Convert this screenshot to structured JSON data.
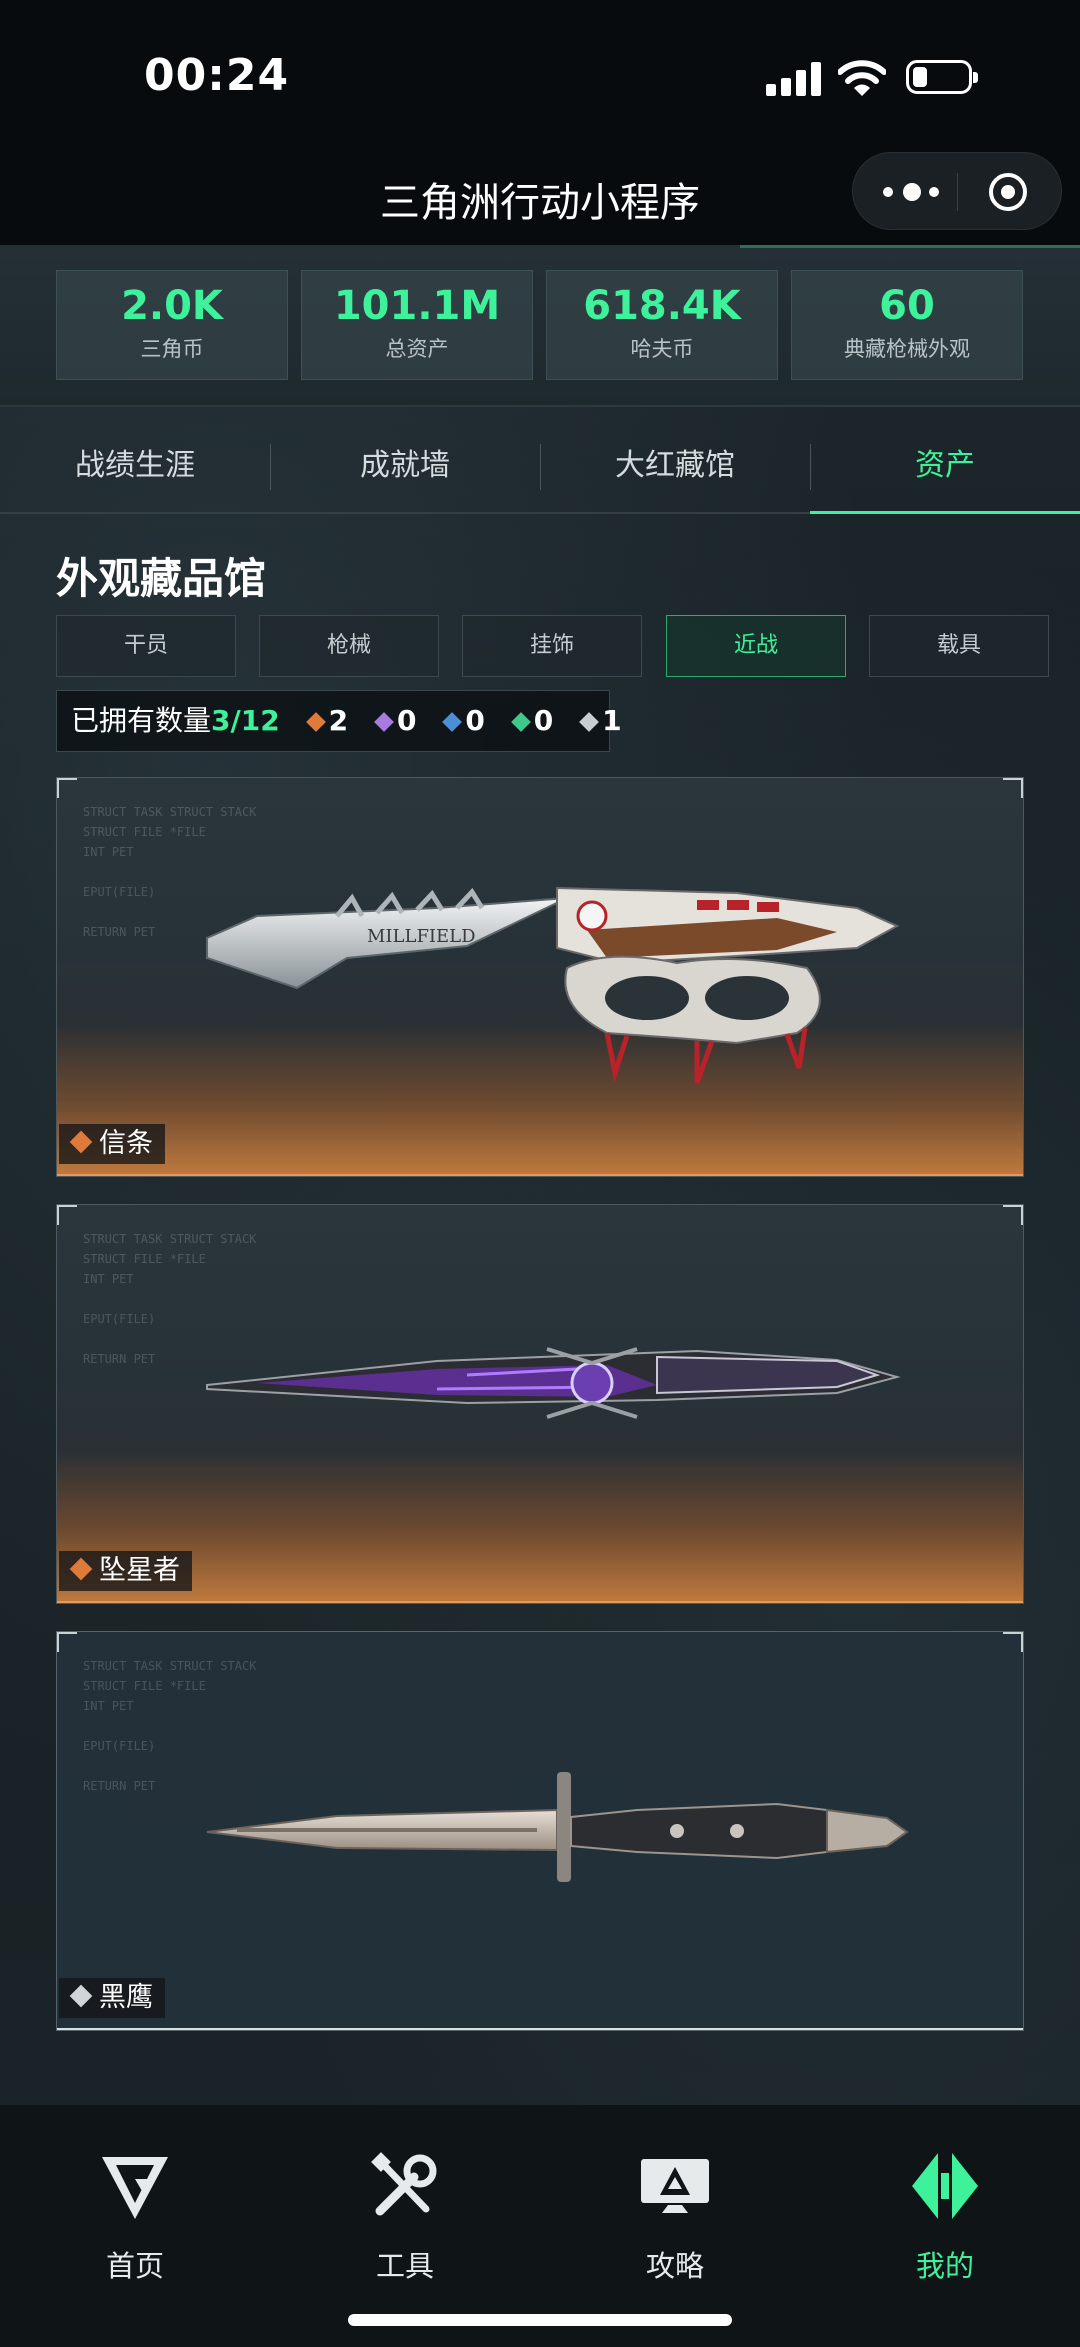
{
  "status_bar": {
    "time": "00:24"
  },
  "title_bar": {
    "title": "三角洲行动小程序"
  },
  "stats": [
    {
      "value": "2.0K",
      "label": "三角币"
    },
    {
      "value": "101.1M",
      "label": "总资产"
    },
    {
      "value": "618.4K",
      "label": "哈夫币"
    },
    {
      "value": "60",
      "label": "典藏枪械外观"
    }
  ],
  "tabs": [
    "战绩生涯",
    "成就墙",
    "大红藏馆",
    "资产"
  ],
  "active_tab": "资产",
  "section": {
    "title": "外观藏品馆",
    "categories": [
      "干员",
      "枪械",
      "挂饰",
      "近战",
      "载具"
    ],
    "active_category": "近战",
    "owned": {
      "label": "已拥有数量",
      "count": "3/12",
      "rarity_counts": [
        {
          "color": "#e07a3a",
          "count": "2"
        },
        {
          "color": "#a77be0",
          "count": "0"
        },
        {
          "color": "#4c8fd6",
          "count": "0"
        },
        {
          "color": "#3ec88a",
          "count": "0"
        },
        {
          "color": "#c8cdd0",
          "count": "1"
        }
      ]
    }
  },
  "items": [
    {
      "name": "信条",
      "rarity_color": "#e07a3a"
    },
    {
      "name": "坠星者",
      "rarity_color": "#e07a3a"
    },
    {
      "name": "黑鹰",
      "rarity_color": "#d0d5d8"
    }
  ],
  "bottom_nav": [
    {
      "label": "首页",
      "icon": "delta-logo-icon"
    },
    {
      "label": "工具",
      "icon": "wrench-screwdriver-icon"
    },
    {
      "label": "攻略",
      "icon": "monitor-guide-icon"
    },
    {
      "label": "我的",
      "icon": "profile-diamond-icon"
    }
  ],
  "colors": {
    "accent": "#3df29a",
    "orange": "#e07a3a"
  }
}
